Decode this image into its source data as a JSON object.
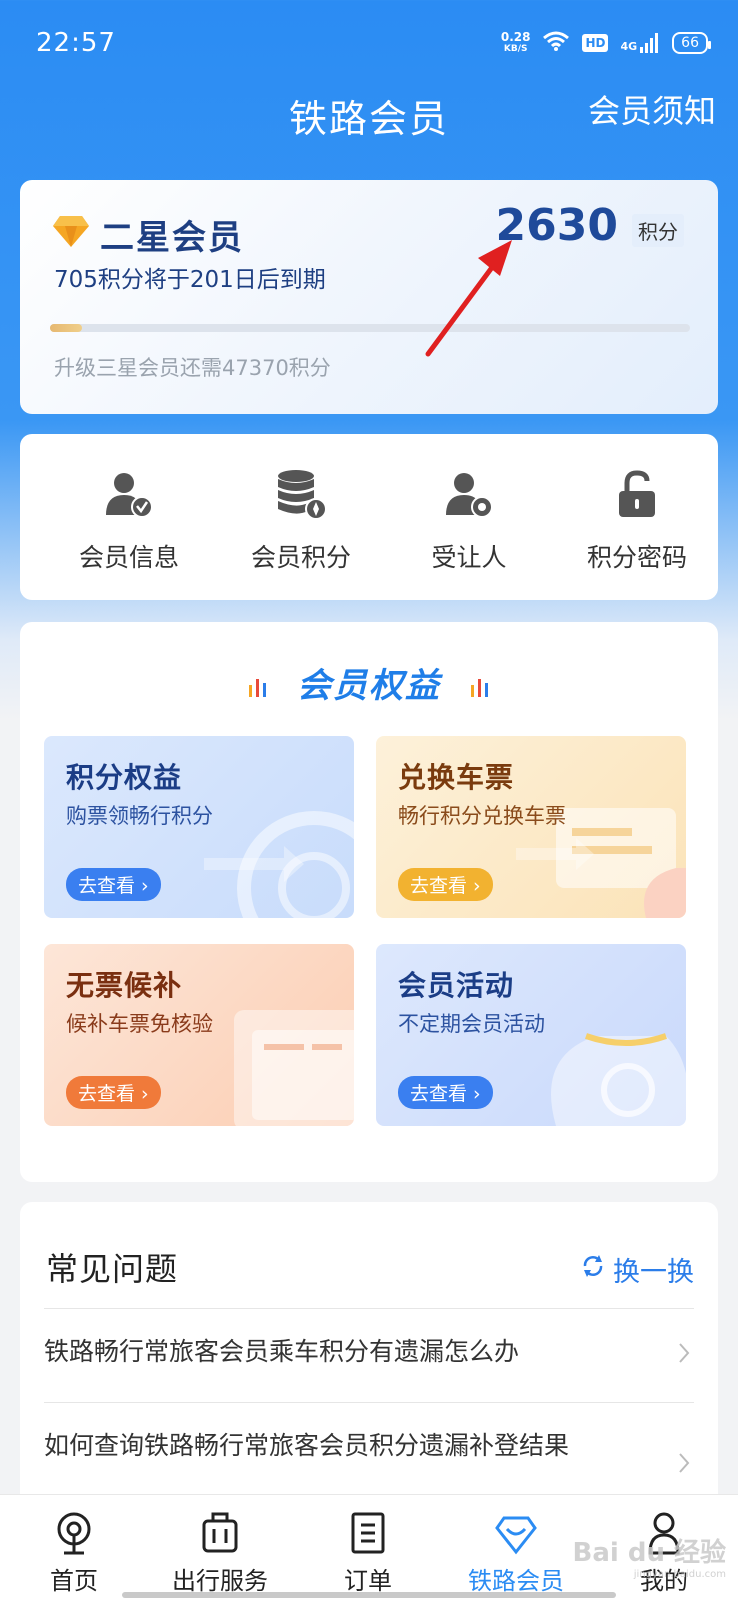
{
  "status_bar": {
    "time": "22:57",
    "net_speed_value": "0.28",
    "net_speed_unit": "KB/S",
    "hd": "HD",
    "network": "4G",
    "battery": "66"
  },
  "header": {
    "title": "铁路会员",
    "notice_link": "会员须知"
  },
  "member_card": {
    "level": "二星会员",
    "points": "2630",
    "points_unit": "积分",
    "expiry": "705积分将于201日后到期",
    "progress_fraction": 0.05,
    "upgrade_hint": "升级三星会员还需47370积分"
  },
  "functions": [
    {
      "label": "会员信息",
      "icon": "member-info-icon"
    },
    {
      "label": "会员积分",
      "icon": "points-database-icon"
    },
    {
      "label": "受让人",
      "icon": "assignee-icon"
    },
    {
      "label": "积分密码",
      "icon": "lock-icon"
    }
  ],
  "benefits": {
    "title": "会员权益",
    "tiles": [
      {
        "title": "积分权益",
        "subtitle": "购票领畅行积分",
        "button": "去查看"
      },
      {
        "title": "兑换车票",
        "subtitle": "畅行积分兑换车票",
        "button": "去查看"
      },
      {
        "title": "无票候补",
        "subtitle": "候补车票免核验",
        "button": "去查看"
      },
      {
        "title": "会员活动",
        "subtitle": "不定期会员活动",
        "button": "去查看"
      }
    ]
  },
  "faq": {
    "title": "常见问题",
    "refresh_label": "换一换",
    "items": [
      "铁路畅行常旅客会员乘车积分有遗漏怎么办",
      "如何查询铁路畅行常旅客会员积分遗漏补登结果"
    ]
  },
  "tabs": [
    {
      "label": "首页",
      "icon": "home-train-icon"
    },
    {
      "label": "出行服务",
      "icon": "luggage-icon"
    },
    {
      "label": "订单",
      "icon": "order-list-icon"
    },
    {
      "label": "铁路会员",
      "icon": "diamond-icon",
      "active": true
    },
    {
      "label": "我的",
      "icon": "profile-icon"
    }
  ],
  "watermark": {
    "text": "Bai du 经验",
    "sub": "jingyan.baidu.com"
  },
  "colors": {
    "primary": "#2b8cf3",
    "title_blue": "#1f4a9a",
    "annotation_red": "#e02020"
  }
}
